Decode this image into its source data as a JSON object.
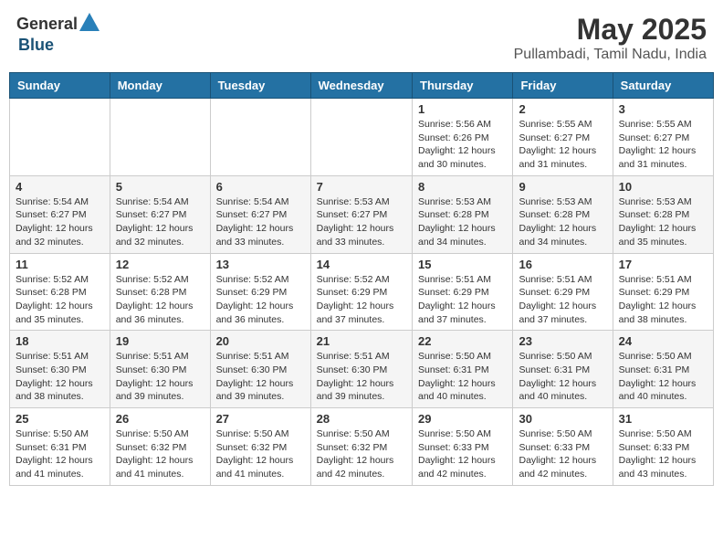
{
  "header": {
    "logo_general": "General",
    "logo_blue": "Blue",
    "title": "May 2025",
    "subtitle": "Pullambadi, Tamil Nadu, India"
  },
  "weekdays": [
    "Sunday",
    "Monday",
    "Tuesday",
    "Wednesday",
    "Thursday",
    "Friday",
    "Saturday"
  ],
  "weeks": [
    [
      {
        "day": "",
        "info": ""
      },
      {
        "day": "",
        "info": ""
      },
      {
        "day": "",
        "info": ""
      },
      {
        "day": "",
        "info": ""
      },
      {
        "day": "1",
        "info": "Sunrise: 5:56 AM\nSunset: 6:26 PM\nDaylight: 12 hours\nand 30 minutes."
      },
      {
        "day": "2",
        "info": "Sunrise: 5:55 AM\nSunset: 6:27 PM\nDaylight: 12 hours\nand 31 minutes."
      },
      {
        "day": "3",
        "info": "Sunrise: 5:55 AM\nSunset: 6:27 PM\nDaylight: 12 hours\nand 31 minutes."
      }
    ],
    [
      {
        "day": "4",
        "info": "Sunrise: 5:54 AM\nSunset: 6:27 PM\nDaylight: 12 hours\nand 32 minutes."
      },
      {
        "day": "5",
        "info": "Sunrise: 5:54 AM\nSunset: 6:27 PM\nDaylight: 12 hours\nand 32 minutes."
      },
      {
        "day": "6",
        "info": "Sunrise: 5:54 AM\nSunset: 6:27 PM\nDaylight: 12 hours\nand 33 minutes."
      },
      {
        "day": "7",
        "info": "Sunrise: 5:53 AM\nSunset: 6:27 PM\nDaylight: 12 hours\nand 33 minutes."
      },
      {
        "day": "8",
        "info": "Sunrise: 5:53 AM\nSunset: 6:28 PM\nDaylight: 12 hours\nand 34 minutes."
      },
      {
        "day": "9",
        "info": "Sunrise: 5:53 AM\nSunset: 6:28 PM\nDaylight: 12 hours\nand 34 minutes."
      },
      {
        "day": "10",
        "info": "Sunrise: 5:53 AM\nSunset: 6:28 PM\nDaylight: 12 hours\nand 35 minutes."
      }
    ],
    [
      {
        "day": "11",
        "info": "Sunrise: 5:52 AM\nSunset: 6:28 PM\nDaylight: 12 hours\nand 35 minutes."
      },
      {
        "day": "12",
        "info": "Sunrise: 5:52 AM\nSunset: 6:28 PM\nDaylight: 12 hours\nand 36 minutes."
      },
      {
        "day": "13",
        "info": "Sunrise: 5:52 AM\nSunset: 6:29 PM\nDaylight: 12 hours\nand 36 minutes."
      },
      {
        "day": "14",
        "info": "Sunrise: 5:52 AM\nSunset: 6:29 PM\nDaylight: 12 hours\nand 37 minutes."
      },
      {
        "day": "15",
        "info": "Sunrise: 5:51 AM\nSunset: 6:29 PM\nDaylight: 12 hours\nand 37 minutes."
      },
      {
        "day": "16",
        "info": "Sunrise: 5:51 AM\nSunset: 6:29 PM\nDaylight: 12 hours\nand 37 minutes."
      },
      {
        "day": "17",
        "info": "Sunrise: 5:51 AM\nSunset: 6:29 PM\nDaylight: 12 hours\nand 38 minutes."
      }
    ],
    [
      {
        "day": "18",
        "info": "Sunrise: 5:51 AM\nSunset: 6:30 PM\nDaylight: 12 hours\nand 38 minutes."
      },
      {
        "day": "19",
        "info": "Sunrise: 5:51 AM\nSunset: 6:30 PM\nDaylight: 12 hours\nand 39 minutes."
      },
      {
        "day": "20",
        "info": "Sunrise: 5:51 AM\nSunset: 6:30 PM\nDaylight: 12 hours\nand 39 minutes."
      },
      {
        "day": "21",
        "info": "Sunrise: 5:51 AM\nSunset: 6:30 PM\nDaylight: 12 hours\nand 39 minutes."
      },
      {
        "day": "22",
        "info": "Sunrise: 5:50 AM\nSunset: 6:31 PM\nDaylight: 12 hours\nand 40 minutes."
      },
      {
        "day": "23",
        "info": "Sunrise: 5:50 AM\nSunset: 6:31 PM\nDaylight: 12 hours\nand 40 minutes."
      },
      {
        "day": "24",
        "info": "Sunrise: 5:50 AM\nSunset: 6:31 PM\nDaylight: 12 hours\nand 40 minutes."
      }
    ],
    [
      {
        "day": "25",
        "info": "Sunrise: 5:50 AM\nSunset: 6:31 PM\nDaylight: 12 hours\nand 41 minutes."
      },
      {
        "day": "26",
        "info": "Sunrise: 5:50 AM\nSunset: 6:32 PM\nDaylight: 12 hours\nand 41 minutes."
      },
      {
        "day": "27",
        "info": "Sunrise: 5:50 AM\nSunset: 6:32 PM\nDaylight: 12 hours\nand 41 minutes."
      },
      {
        "day": "28",
        "info": "Sunrise: 5:50 AM\nSunset: 6:32 PM\nDaylight: 12 hours\nand 42 minutes."
      },
      {
        "day": "29",
        "info": "Sunrise: 5:50 AM\nSunset: 6:33 PM\nDaylight: 12 hours\nand 42 minutes."
      },
      {
        "day": "30",
        "info": "Sunrise: 5:50 AM\nSunset: 6:33 PM\nDaylight: 12 hours\nand 42 minutes."
      },
      {
        "day": "31",
        "info": "Sunrise: 5:50 AM\nSunset: 6:33 PM\nDaylight: 12 hours\nand 43 minutes."
      }
    ]
  ]
}
